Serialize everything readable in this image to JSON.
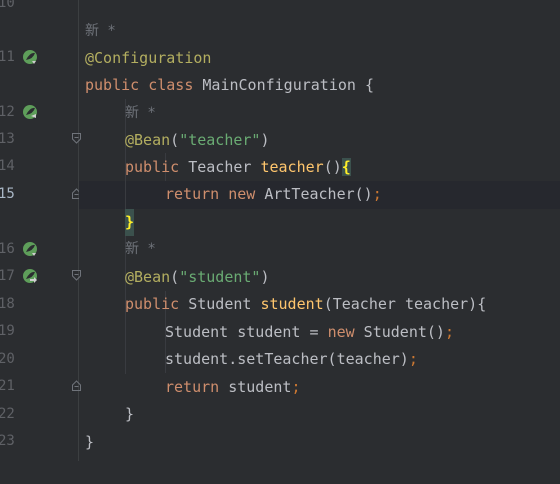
{
  "editor": {
    "line_numbers": [
      "10",
      "11",
      "",
      "12",
      "13",
      "14",
      "15",
      "",
      "16",
      "17",
      "18",
      "19",
      "20",
      "21",
      "22",
      "23"
    ],
    "lines": {
      "hint_top": "新 *",
      "annotation_configuration": "@Configuration",
      "class_kw_public": "public",
      "class_kw_class": "class",
      "class_name": "MainConfiguration",
      "class_open": " {",
      "hint_1": "新 *",
      "bean1_ann": "@Bean",
      "bean1_open": "(",
      "bean1_str": "\"teacher\"",
      "bean1_close": ")",
      "m1_public": "public",
      "m1_type": "Teacher",
      "m1_name": "teacher",
      "m1_parens": "()",
      "m1_brace": "{",
      "r1_return": "return",
      "r1_new": "new",
      "r1_call": "ArtTeacher()",
      "r1_semi": ";",
      "close1": "}",
      "hint_2": "新 *",
      "bean2_ann": "@Bean",
      "bean2_open": "(",
      "bean2_str": "\"student\"",
      "bean2_close": ")",
      "m2_public": "public",
      "m2_type": "Student",
      "m2_name": "student",
      "m2_params": "(Teacher teacher){",
      "s1_decl": "Student student = ",
      "s1_new": "new",
      "s1_call": " Student()",
      "s1_semi": ";",
      "s2_call": "student.setTeacher(teacher)",
      "s2_semi": ";",
      "s3_return": "return",
      "s3_var": " student",
      "s3_semi": ";",
      "close2": "}",
      "close_class": "}"
    }
  },
  "colors": {
    "background": "#2b2d30",
    "keyword": "#cf8e6d",
    "annotation": "#b3ae60",
    "string": "#6aab73",
    "method_decl": "#ffc66d",
    "text": "#bcbec4"
  }
}
